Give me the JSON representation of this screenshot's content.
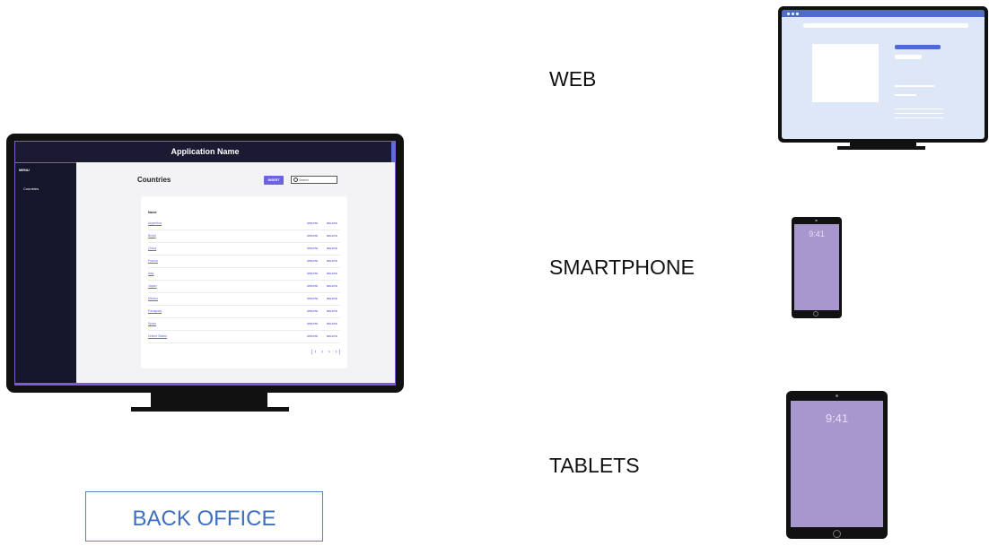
{
  "back_office_app": {
    "app_name": "Application Name",
    "menu_title": "MENU",
    "menu_items": [
      "Countries"
    ],
    "page_title": "Countries",
    "insert_label": "INSERT",
    "search_placeholder": "Search",
    "column_header": "Name",
    "update_label": "UPDATE",
    "delete_label": "DELETE",
    "countries": [
      "Argentina",
      "Brazil",
      "China",
      "France",
      "Italy",
      "Japan",
      "Mexico",
      "Paraguay",
      "Spain",
      "United States"
    ],
    "pager_icons": [
      "first-page-icon",
      "prev-page-icon",
      "next-page-icon",
      "last-page-icon"
    ]
  },
  "back_office_button": "BACK OFFICE",
  "platform_labels": {
    "web": "WEB",
    "smartphone": "SMARTPHONE",
    "tablets": "TABLETS"
  },
  "device_screens": {
    "phone_time": "9:41",
    "tablet_time": "9:41"
  },
  "colors": {
    "accent": "#6b63e0",
    "header_bg": "#1c1a33",
    "sidebar_bg": "#15152b",
    "device_screen": "#a896cf",
    "web_mockup_bg": "#dde7f7",
    "web_mockup_accent": "#4f6bd0",
    "back_office_text": "#3f6fbf"
  }
}
